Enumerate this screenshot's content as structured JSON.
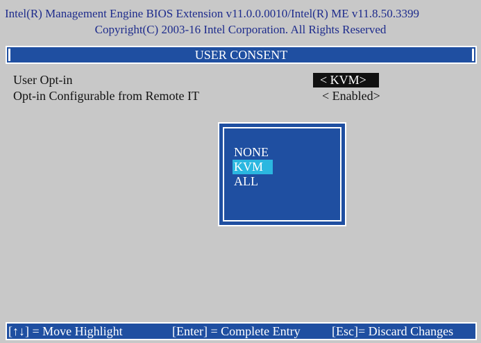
{
  "header": {
    "line1": "Intel(R) Management Engine BIOS Extension v11.0.0.0010/Intel(R) ME v11.8.50.3399",
    "line2": "Copyright(C) 2003-16 Intel Corporation. All Rights Reserved"
  },
  "screen": {
    "title": "USER CONSENT"
  },
  "settings": [
    {
      "label": "User Opt-in",
      "value": "< KVM>"
    },
    {
      "label": "Opt-in Configurable from Remote IT",
      "value": "< Enabled>"
    }
  ],
  "popup": {
    "options": [
      "NONE",
      "KVM",
      "ALL"
    ],
    "selected": "KVM"
  },
  "footer": {
    "move": "[↑↓] = Move Highlight",
    "enter": "[Enter] = Complete Entry",
    "esc": "[Esc]= Discard Changes"
  },
  "colors": {
    "panel_blue": "#1f4fa1",
    "highlight_cyan": "#2bb7e0",
    "header_text": "#1d2b8c",
    "background": "#c8c8c8"
  }
}
